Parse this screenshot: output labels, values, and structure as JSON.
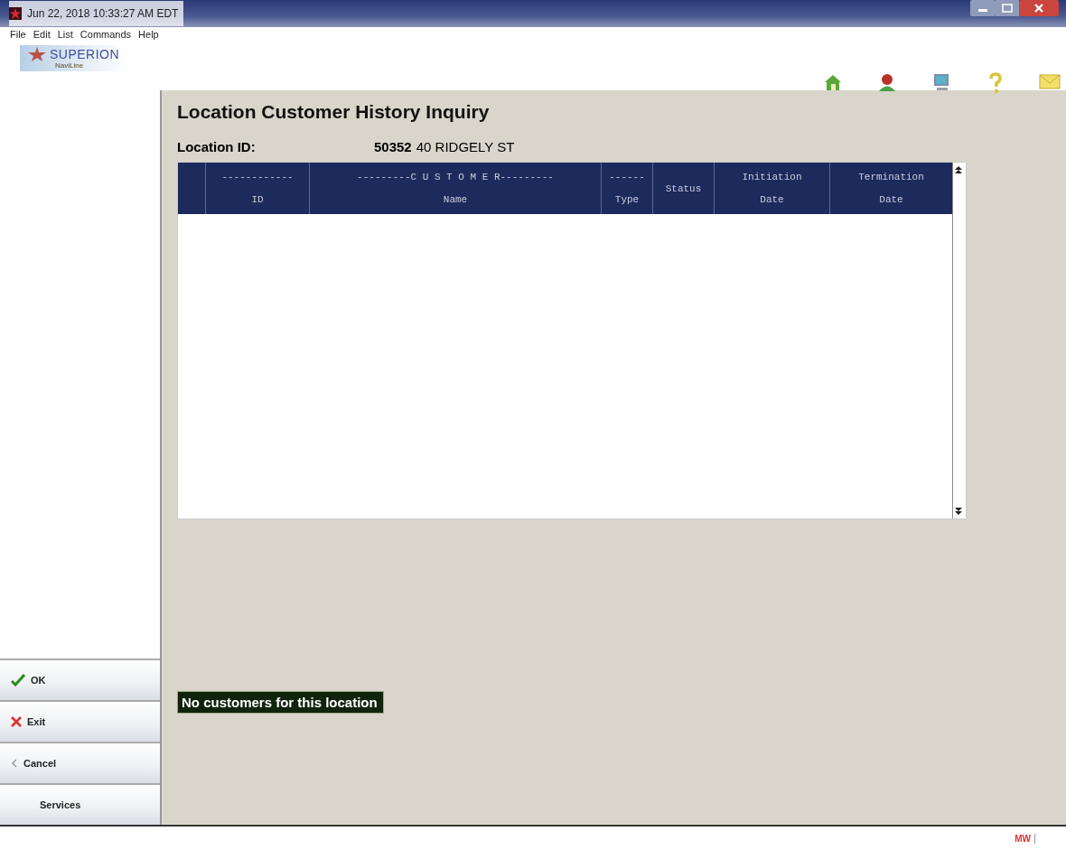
{
  "window": {
    "title": "Jun 22, 2018  10:33:27 AM EDT"
  },
  "menu": [
    "File",
    "Edit",
    "List",
    "Commands",
    "Help"
  ],
  "logo": {
    "name": "SUPERION",
    "product": "NaviLine"
  },
  "page": {
    "title": "Location Customer History Inquiry",
    "location_label": "Location ID:",
    "location_id": "50352",
    "address": "40 RIDGELY ST"
  },
  "table": {
    "columns": [
      {
        "lines": [
          "------------",
          "ID"
        ]
      },
      {
        "lines": [
          "---------C U S T O M E R---------",
          "Name"
        ]
      },
      {
        "lines": [
          "------",
          "Type"
        ]
      },
      {
        "lines": [
          "Status"
        ]
      },
      {
        "lines": [
          "Initiation",
          "Date"
        ]
      },
      {
        "lines": [
          "Termination",
          "Date"
        ]
      }
    ]
  },
  "buttons": [
    {
      "label": "OK",
      "kind": "ok"
    },
    {
      "label": "Exit",
      "kind": "exit"
    },
    {
      "label": "Cancel",
      "kind": "cancel"
    },
    {
      "label": "Services",
      "kind": "plain"
    }
  ],
  "message": "No customers for this location",
  "status_bar": {
    "user": "MW"
  }
}
